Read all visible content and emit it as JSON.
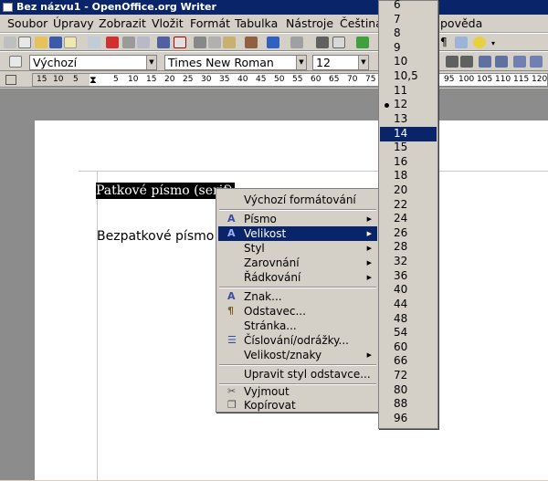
{
  "window": {
    "title": "Bez názvu1 - OpenOffice.org Writer"
  },
  "menu": [
    "Soubor",
    "Úpravy",
    "Zobrazit",
    "Vložit",
    "Formát",
    "Tabulka",
    "Nástroje",
    "Čeština",
    "Nápověda"
  ],
  "formatting": {
    "style": "Výchozí",
    "font": "Times New Roman",
    "size": "12"
  },
  "ruler": [
    "15",
    "10",
    "5",
    "5",
    "10",
    "15",
    "20",
    "25",
    "30",
    "35",
    "40",
    "45",
    "50",
    "55",
    "60",
    "65",
    "70",
    "75",
    "95",
    "100",
    "105",
    "110",
    "115",
    "120"
  ],
  "document": {
    "line1": "Patkové písmo (serif)",
    "line2": "Bezpatkové písmo"
  },
  "context_menu": {
    "items": [
      {
        "label": "Výchozí formátování",
        "icon": "",
        "submenu": false
      },
      {
        "label": "Písmo",
        "icon": "font-icon",
        "submenu": true
      },
      {
        "label": "Velikost",
        "icon": "font-size-icon",
        "submenu": true,
        "selected": true
      },
      {
        "label": "Styl",
        "icon": "",
        "submenu": true
      },
      {
        "label": "Zarovnání",
        "icon": "",
        "submenu": true
      },
      {
        "label": "Řádkování",
        "icon": "",
        "submenu": true
      },
      {
        "label": "Znak...",
        "icon": "character-icon",
        "submenu": false
      },
      {
        "label": "Odstavec...",
        "icon": "paragraph-icon",
        "submenu": false
      },
      {
        "label": "Stránka...",
        "icon": "",
        "submenu": false
      },
      {
        "label": "Číslování/odrážky...",
        "icon": "bullets-icon",
        "submenu": false
      },
      {
        "label": "Velikost/znaky",
        "icon": "",
        "submenu": true
      },
      {
        "label": "Upravit styl odstavce...",
        "icon": "",
        "submenu": false
      },
      {
        "label": "Vyjmout",
        "icon": "scissors-icon",
        "submenu": false
      },
      {
        "label": "Kopírovat",
        "icon": "copy-icon",
        "submenu": false
      }
    ]
  },
  "sizes": {
    "values": [
      "6",
      "7",
      "8",
      "9",
      "10",
      "10,5",
      "11",
      "12",
      "13",
      "14",
      "15",
      "16",
      "18",
      "20",
      "22",
      "24",
      "26",
      "28",
      "32",
      "36",
      "40",
      "44",
      "48",
      "54",
      "60",
      "66",
      "72",
      "80",
      "88",
      "96"
    ],
    "checked": "12",
    "highlighted": "14"
  },
  "colors": {
    "selection": "#0a246a",
    "title_bar": "#0a246a"
  }
}
